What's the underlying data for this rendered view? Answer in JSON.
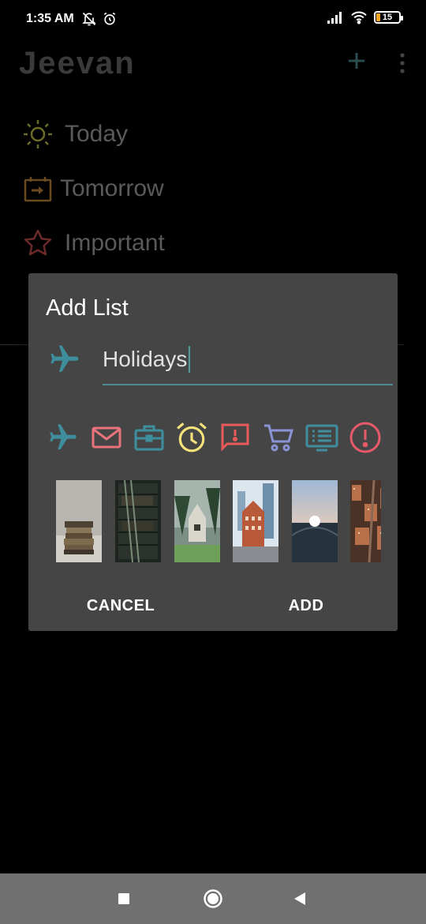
{
  "status_bar": {
    "time": "1:35 AM",
    "battery": "15",
    "icons": [
      "notifications-off-icon",
      "alarm-icon",
      "signal-icon",
      "wifi-icon",
      "battery-icon"
    ]
  },
  "app": {
    "title": "Jeevan",
    "nav_items": [
      {
        "label": "Today",
        "icon": "sun-icon"
      },
      {
        "label": "Tomorrow",
        "icon": "calendar-arrow-icon"
      },
      {
        "label": "Important",
        "icon": "star-icon"
      }
    ]
  },
  "dialog": {
    "title": "Add List",
    "input_value": "Holidays",
    "selected_icon": "airplane-icon",
    "icons": [
      {
        "name": "airplane-icon",
        "color": "#3e8e9e"
      },
      {
        "name": "mail-icon",
        "color": "#e8737a"
      },
      {
        "name": "briefcase-icon",
        "color": "#3e8e9e"
      },
      {
        "name": "alarm-clock-icon",
        "color": "#f5e27a"
      },
      {
        "name": "feedback-icon",
        "color": "#e85a5a"
      },
      {
        "name": "cart-icon",
        "color": "#8a93d6"
      },
      {
        "name": "list-icon",
        "color": "#3e8e9e"
      },
      {
        "name": "alert-icon",
        "color": "#e85a6a"
      }
    ],
    "backgrounds": [
      "books-stack",
      "library-shelves",
      "forest-house",
      "city-buildings",
      "sunset-aerial",
      "city-street"
    ],
    "cancel_label": "CANCEL",
    "add_label": "ADD"
  },
  "colors": {
    "accent": "#4e8a92",
    "dialog_bg": "#454545",
    "nav_bar": "#707070"
  }
}
